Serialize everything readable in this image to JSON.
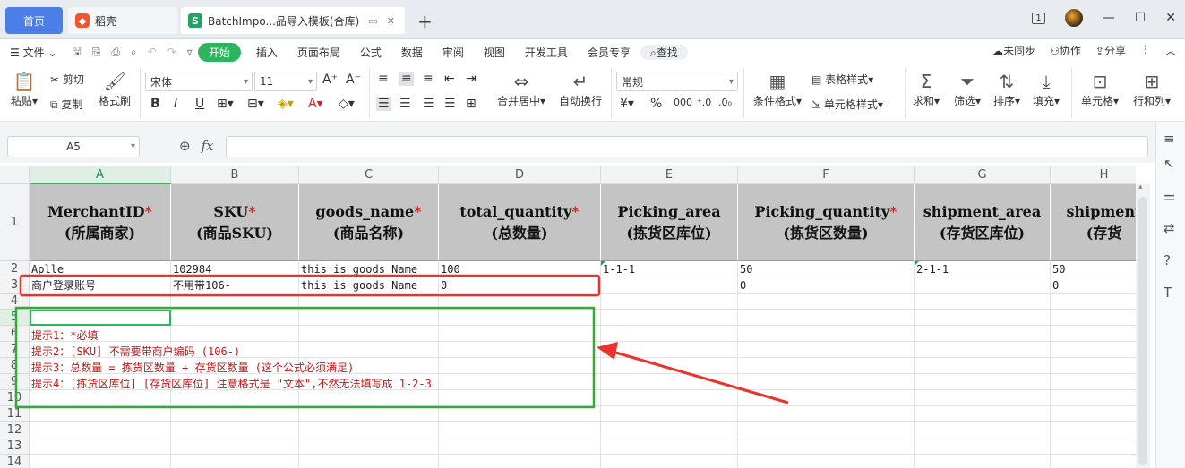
{
  "tabs": {
    "home": "首页",
    "daoke": "稻壳",
    "daoke_icon": "daoke-logo-icon",
    "active": "BatchImpo...品导入模板(合库)",
    "active_icon": "sheet-s-icon",
    "new_tab": "+"
  },
  "window": {
    "badge": "1"
  },
  "menu": {
    "file": "文件",
    "items": [
      "开始",
      "插入",
      "页面布局",
      "公式",
      "数据",
      "审阅",
      "视图",
      "开发工具",
      "会员专享"
    ],
    "search": "查找",
    "right": [
      "未同步",
      "协作",
      "分享"
    ]
  },
  "ribbon": {
    "paste": "粘贴",
    "cut": "剪切",
    "copy": "复制",
    "format_painter": "格式刷",
    "font_name": "宋体",
    "font_size": "11",
    "merge": "合并居中",
    "wrap": "自动换行",
    "number_format": "常规",
    "cond_format": "条件格式",
    "table_style": "表格样式",
    "cell_style": "单元格样式",
    "sum": "求和",
    "filter": "筛选",
    "sort": "排序",
    "fill": "填充",
    "cell": "单元格",
    "rowcol": "行和列"
  },
  "formula_bar": {
    "name_box": "A5",
    "fx": "fx"
  },
  "sheet": {
    "columns": [
      "A",
      "B",
      "C",
      "D",
      "E",
      "F",
      "G",
      "H"
    ],
    "rows": [
      "1",
      "2",
      "3",
      "4",
      "5",
      "6",
      "7",
      "8",
      "9",
      "10",
      "11",
      "12",
      "13",
      "14"
    ],
    "headers": [
      {
        "en": "MerchantID",
        "star": "*",
        "cn": "(所属商家)"
      },
      {
        "en": "SKU",
        "star": "*",
        "cn": "(商品SKU)"
      },
      {
        "en": "goods_name",
        "star": "*",
        "cn": "(商品名称)"
      },
      {
        "en": "total_quantity",
        "star": "*",
        "cn": "(总数量)"
      },
      {
        "en": "Picking_area",
        "star": "",
        "cn": "(拣货区库位)"
      },
      {
        "en": "Picking_quantity",
        "star": "*",
        "cn": "(拣货区数量)"
      },
      {
        "en": "shipment_area",
        "star": "",
        "cn": "(存货区库位)"
      },
      {
        "en": "shipment",
        "star": "",
        "cn": "(存货"
      }
    ],
    "row2": [
      "Aplle",
      "102984",
      "this is goods Name",
      "100",
      "1-1-1",
      "50",
      "2-1-1",
      "50"
    ],
    "row3": [
      "商户登录账号",
      "不用带106-",
      "this is goods Name",
      "0",
      "",
      "0",
      "",
      "0"
    ],
    "hints": [
      "提示1：*必填",
      "提示2：[SKU] 不需要带商户编码 (106-)",
      "提示3：总数量 =  拣货区数量 + 存货区数量  (这个公式必须满足)",
      "提示4：[拣货区库位] [存货区库位] 注意格式是 \"文本\",不然无法填写成 1-2-3"
    ]
  },
  "annotation_colors": {
    "red_box": "#e8342c",
    "green_box": "#3aa835",
    "arrow": "#e8342c"
  }
}
